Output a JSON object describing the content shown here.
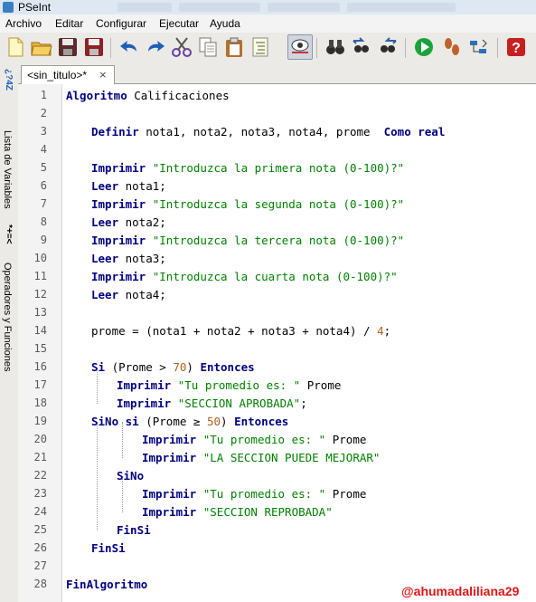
{
  "window": {
    "title": "PSeInt"
  },
  "menu": [
    "Archivo",
    "Editar",
    "Configurar",
    "Ejecutar",
    "Ayuda"
  ],
  "toolbar": [
    {
      "name": "new-file-icon",
      "color": "#f4d35e"
    },
    {
      "name": "open-folder-icon",
      "color": "#e0a526"
    },
    {
      "name": "save-icon",
      "color": "#7a2b2b"
    },
    {
      "name": "save-as-icon",
      "color": "#a12a2a"
    },
    {
      "name": "undo-icon",
      "color": "#1c5fb8"
    },
    {
      "name": "redo-icon",
      "color": "#1c5fb8"
    },
    {
      "name": "cut-icon",
      "color": "#6a3fa0"
    },
    {
      "name": "copy-icon",
      "color": "#7e7e7e"
    },
    {
      "name": "paste-icon",
      "color": "#a0612a"
    },
    {
      "name": "indent-icon",
      "color": "#6b6b6b"
    },
    {
      "name": "find-icon",
      "color": "#333333"
    },
    {
      "name": "binoculars-icon",
      "color": "#2d2d2d"
    },
    {
      "name": "find-previous-icon",
      "color": "#2d5fa8"
    },
    {
      "name": "find-next-icon",
      "color": "#2d5fa8"
    },
    {
      "name": "run-icon",
      "color": "#1aa33a"
    },
    {
      "name": "step-icon",
      "color": "#c0622d"
    },
    {
      "name": "flowchart-icon",
      "color": "#2d6fb8"
    },
    {
      "name": "help-icon",
      "color": "#c62020"
    }
  ],
  "sidebar": {
    "variables_label": "Lista de Variables",
    "operators_label": "Operadores y Funciones",
    "variables_icon": "*+=<",
    "operators_icon": "¿?4Z"
  },
  "tab": {
    "label": "<sin_titulo>*",
    "close": "×"
  },
  "code": [
    {
      "n": "1",
      "indent": 0,
      "tokens": [
        [
          "kw",
          "Algoritmo"
        ],
        [
          "t",
          " Calificaciones"
        ]
      ]
    },
    {
      "n": "2",
      "indent": 0,
      "tokens": []
    },
    {
      "n": "3",
      "indent": 1,
      "tokens": [
        [
          "kw",
          "Definir"
        ],
        [
          "t",
          " nota1, nota2, nota3, nota4, prome  "
        ],
        [
          "kw",
          "Como real"
        ]
      ]
    },
    {
      "n": "4",
      "indent": 0,
      "tokens": []
    },
    {
      "n": "5",
      "indent": 1,
      "tokens": [
        [
          "kw",
          "Imprimir"
        ],
        [
          "t",
          " "
        ],
        [
          "str",
          "\"Introduzca la primera nota (0-100)?\""
        ]
      ]
    },
    {
      "n": "6",
      "indent": 1,
      "tokens": [
        [
          "kw",
          "Leer"
        ],
        [
          "t",
          " nota1;"
        ]
      ]
    },
    {
      "n": "7",
      "indent": 1,
      "tokens": [
        [
          "kw",
          "Imprimir"
        ],
        [
          "t",
          " "
        ],
        [
          "str",
          "\"Introduzca la segunda nota (0-100)?\""
        ]
      ]
    },
    {
      "n": "8",
      "indent": 1,
      "tokens": [
        [
          "kw",
          "Leer"
        ],
        [
          "t",
          " nota2;"
        ]
      ]
    },
    {
      "n": "9",
      "indent": 1,
      "tokens": [
        [
          "kw",
          "Imprimir"
        ],
        [
          "t",
          " "
        ],
        [
          "str",
          "\"Introduzca la tercera nota (0-100)?\""
        ]
      ]
    },
    {
      "n": "10",
      "indent": 1,
      "tokens": [
        [
          "kw",
          "Leer"
        ],
        [
          "t",
          " nota3;"
        ]
      ]
    },
    {
      "n": "11",
      "indent": 1,
      "tokens": [
        [
          "kw",
          "Imprimir"
        ],
        [
          "t",
          " "
        ],
        [
          "str",
          "\"Introduzca la cuarta nota (0-100)?\""
        ]
      ]
    },
    {
      "n": "12",
      "indent": 1,
      "tokens": [
        [
          "kw",
          "Leer"
        ],
        [
          "t",
          " nota4;"
        ]
      ]
    },
    {
      "n": "13",
      "indent": 0,
      "tokens": []
    },
    {
      "n": "14",
      "indent": 1,
      "tokens": [
        [
          "t",
          "prome = (nota1 + nota2 + nota3 + nota4) / "
        ],
        [
          "num",
          "4"
        ],
        [
          "t",
          ";"
        ]
      ]
    },
    {
      "n": "15",
      "indent": 0,
      "tokens": []
    },
    {
      "n": "16",
      "indent": 1,
      "tokens": [
        [
          "kw",
          "Si"
        ],
        [
          "t",
          " (Prome > "
        ],
        [
          "num",
          "70"
        ],
        [
          "t",
          ") "
        ],
        [
          "kw",
          "Entonces"
        ]
      ]
    },
    {
      "n": "17",
      "indent": 2,
      "tokens": [
        [
          "kw",
          "Imprimir"
        ],
        [
          "t",
          " "
        ],
        [
          "str",
          "\"Tu promedio es: \""
        ],
        [
          "t",
          " Prome"
        ]
      ]
    },
    {
      "n": "18",
      "indent": 2,
      "tokens": [
        [
          "kw",
          "Imprimir"
        ],
        [
          "t",
          " "
        ],
        [
          "str",
          "\"SECCION APROBADA\""
        ],
        [
          "t",
          ";"
        ]
      ]
    },
    {
      "n": "19",
      "indent": 1,
      "tokens": [
        [
          "kw",
          "SiNo si"
        ],
        [
          "t",
          " (Prome ≥ "
        ],
        [
          "num",
          "50"
        ],
        [
          "t",
          ") "
        ],
        [
          "kw",
          "Entonces"
        ]
      ]
    },
    {
      "n": "20",
      "indent": 3,
      "tokens": [
        [
          "kw",
          "Imprimir"
        ],
        [
          "t",
          " "
        ],
        [
          "str",
          "\"Tu promedio es: \""
        ],
        [
          "t",
          " Prome"
        ]
      ]
    },
    {
      "n": "21",
      "indent": 3,
      "tokens": [
        [
          "kw",
          "Imprimir"
        ],
        [
          "t",
          " "
        ],
        [
          "str",
          "\"LA SECCION PUEDE MEJORAR\""
        ]
      ]
    },
    {
      "n": "22",
      "indent": 2,
      "tokens": [
        [
          "kw",
          "SiNo"
        ]
      ]
    },
    {
      "n": "23",
      "indent": 3,
      "tokens": [
        [
          "kw",
          "Imprimir"
        ],
        [
          "t",
          " "
        ],
        [
          "str",
          "\"Tu promedio es: \""
        ],
        [
          "t",
          " Prome"
        ]
      ]
    },
    {
      "n": "24",
      "indent": 3,
      "tokens": [
        [
          "kw",
          "Imprimir"
        ],
        [
          "t",
          " "
        ],
        [
          "str",
          "\"SECCION REPROBADA\""
        ]
      ]
    },
    {
      "n": "25",
      "indent": 2,
      "tokens": [
        [
          "kw",
          "FinSi"
        ]
      ]
    },
    {
      "n": "26",
      "indent": 1,
      "tokens": [
        [
          "kw",
          "FinSi"
        ]
      ]
    },
    {
      "n": "27",
      "indent": 0,
      "tokens": []
    },
    {
      "n": "28",
      "indent": 0,
      "tokens": [
        [
          "kw",
          "FinAlgoritmo"
        ]
      ]
    }
  ],
  "watermark": "@ahumadaliliana29",
  "colors": {
    "keyword": "#000080",
    "string": "#008000",
    "number": "#b0611f",
    "watermark": "#e01616"
  }
}
